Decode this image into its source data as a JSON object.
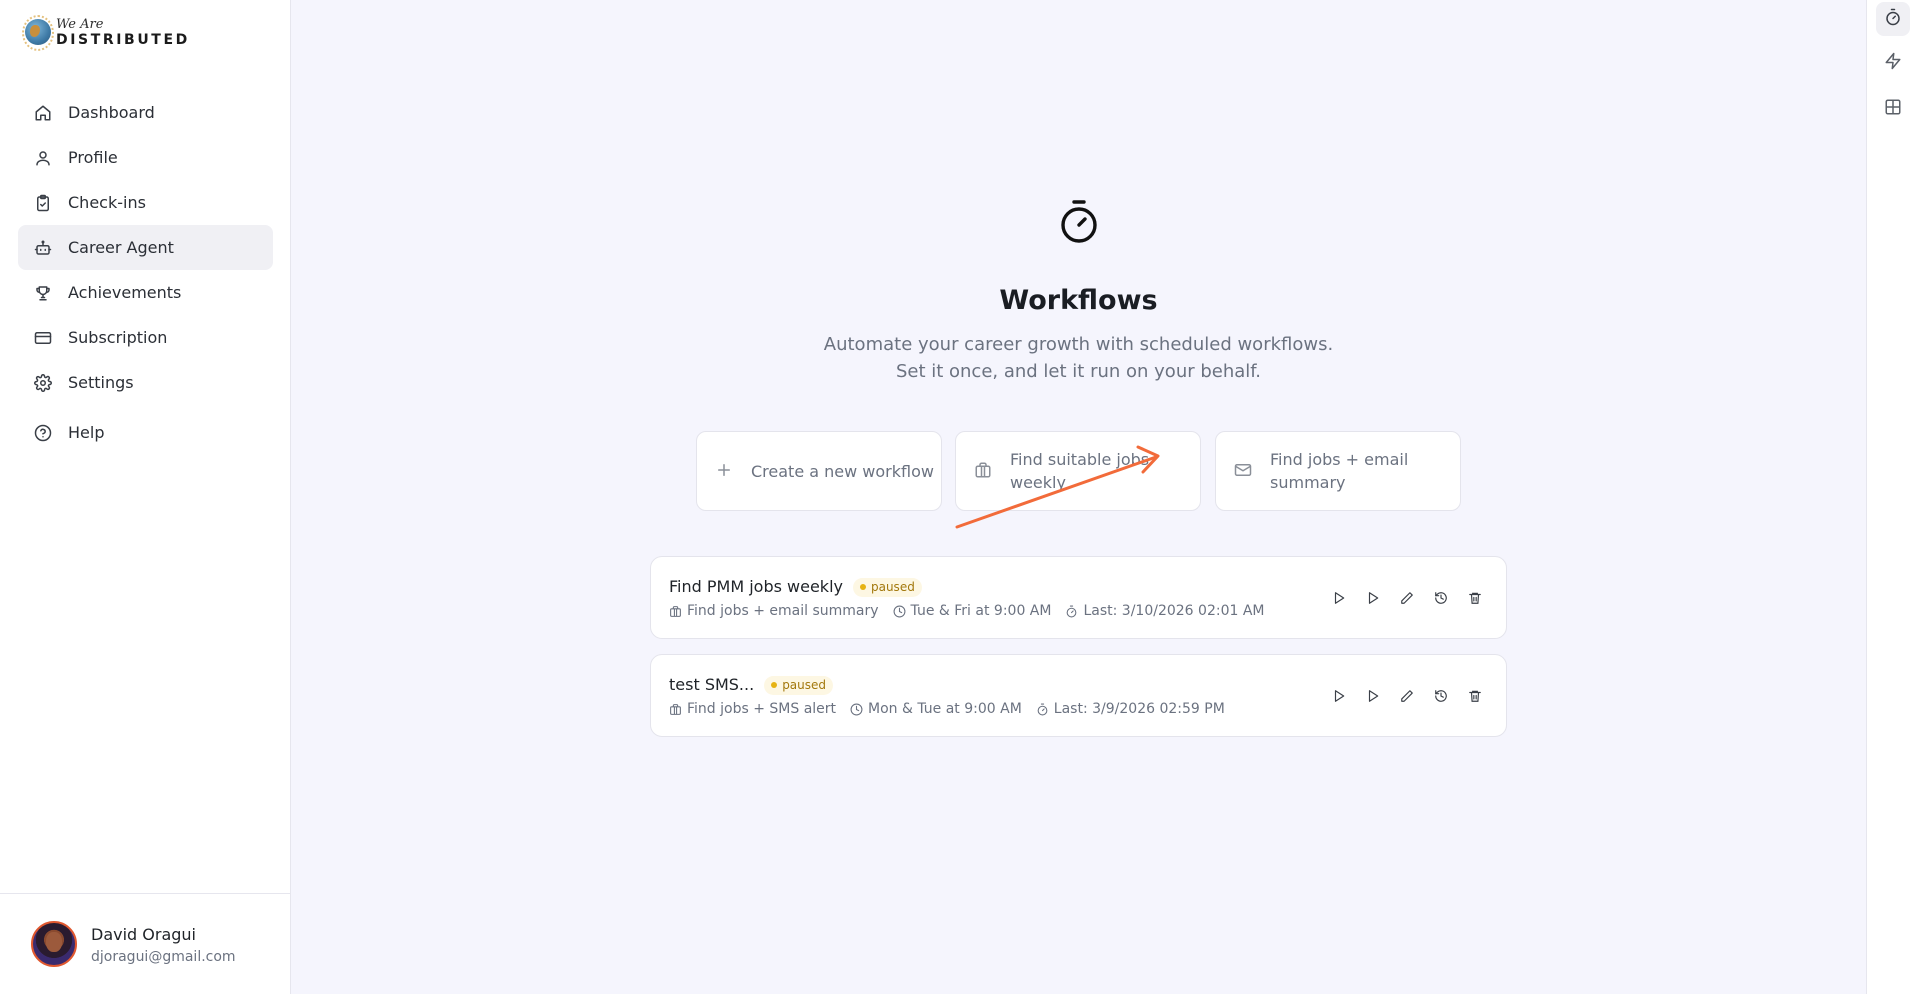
{
  "brand": {
    "line1": "We Are",
    "line2": "DISTRIBUTED"
  },
  "sidebar": {
    "items": [
      {
        "label": "Dashboard",
        "icon": "home-icon"
      },
      {
        "label": "Profile",
        "icon": "user-icon"
      },
      {
        "label": "Check-ins",
        "icon": "clipboard-check-icon"
      },
      {
        "label": "Career Agent",
        "icon": "bot-icon",
        "active": true
      },
      {
        "label": "Achievements",
        "icon": "trophy-icon"
      },
      {
        "label": "Subscription",
        "icon": "credit-card-icon"
      },
      {
        "label": "Settings",
        "icon": "gear-icon"
      },
      {
        "label": "Help",
        "icon": "help-circle-icon"
      }
    ]
  },
  "user": {
    "name": "David Oragui",
    "email": "djoragui@gmail.com"
  },
  "rail": {
    "icons": [
      "timer-icon",
      "zap-icon",
      "grid-icon"
    ]
  },
  "main": {
    "title": "Workflows",
    "subtitle": "Automate your career growth with scheduled workflows. Set it once, and let it run on your behalf.",
    "quick_actions": [
      {
        "label": "Create a new workflow",
        "icon": "plus-icon"
      },
      {
        "label": "Find suitable jobs weekly",
        "icon": "briefcase-icon"
      },
      {
        "label": "Find jobs + email summary",
        "icon": "mail-icon"
      }
    ],
    "workflows": [
      {
        "name": "Find PMM jobs weekly",
        "status": "paused",
        "type": "Find jobs + email summary",
        "schedule": "Tue & Fri at 9:00 AM",
        "last": "Last: 3/10/2026 02:01 AM"
      },
      {
        "name": "test SMS...",
        "status": "paused",
        "type": "Find jobs + SMS alert",
        "schedule": "Mon & Tue at 9:00 AM",
        "last": "Last: 3/9/2026 02:59 PM"
      }
    ]
  },
  "colors": {
    "accent_arrow": "#f26b3a",
    "badge_bg": "#fdf7e3",
    "badge_text": "#a3780c",
    "background": "#f5f5fd"
  }
}
